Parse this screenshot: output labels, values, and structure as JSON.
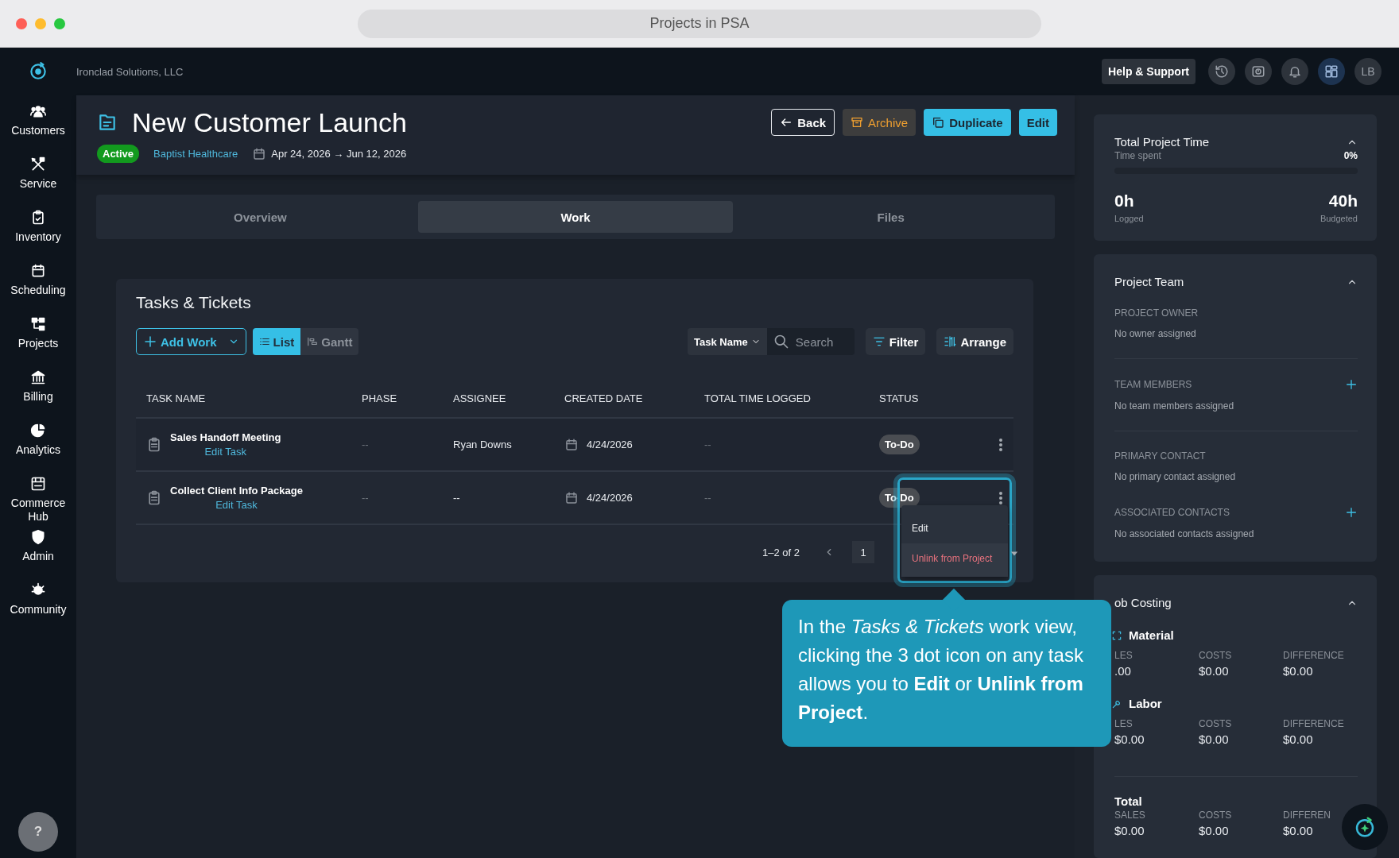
{
  "window": {
    "title": "Projects in PSA"
  },
  "topbar": {
    "company": "Ironclad Solutions, LLC",
    "help": "Help & Support",
    "avatar": "LB"
  },
  "sidebar": {
    "items": [
      {
        "label": "Customers"
      },
      {
        "label": "Service"
      },
      {
        "label": "Inventory"
      },
      {
        "label": "Scheduling"
      },
      {
        "label": "Projects"
      },
      {
        "label": "Billing"
      },
      {
        "label": "Analytics"
      },
      {
        "label": "Commerce Hub"
      },
      {
        "label": "Admin"
      },
      {
        "label": "Community"
      }
    ],
    "help_button": "?"
  },
  "project": {
    "title": "New Customer Launch",
    "status": {
      "label": "Active",
      "kind": "active"
    },
    "customer": "Baptist Healthcare",
    "dates": "Apr 24, 2026 → Jun 12, 2026",
    "actions": [
      {
        "label": "Back",
        "kind": "outline"
      },
      {
        "label": "Archive",
        "kind": "warning"
      },
      {
        "label": "Duplicate",
        "kind": "primary"
      },
      {
        "label": "Edit",
        "kind": "primary"
      }
    ]
  },
  "tabs": [
    {
      "label": "Overview",
      "selected": false
    },
    {
      "label": "Work",
      "selected": true
    },
    {
      "label": "Files",
      "selected": false
    }
  ],
  "tasks": {
    "title": "Tasks & Tickets",
    "add_work": "Add Work",
    "views": [
      {
        "label": "List",
        "selected": true
      },
      {
        "label": "Gantt",
        "selected": false
      }
    ],
    "search_by": "Task Name",
    "search": {
      "placeholder": "Search"
    },
    "filter": "Filter",
    "arrange": "Arrange",
    "columns": [
      "TASK NAME",
      "PHASE",
      "ASSIGNEE",
      "CREATED DATE",
      "TOTAL TIME LOGGED",
      "STATUS"
    ],
    "rows": [
      {
        "name": "Sales Handoff Meeting",
        "link": "Edit Task",
        "phase": "--",
        "assignee": "Ryan Downs",
        "created": "4/24/2026",
        "time": "--",
        "status": "To-Do"
      },
      {
        "name": "Collect Client Info Package",
        "link": "Edit Task",
        "phase": "--",
        "assignee": "--",
        "created": "4/24/2026",
        "time": "--",
        "status": "To-Do"
      }
    ],
    "pagination": {
      "range": "1–2 of 2",
      "page": "1"
    },
    "menu": {
      "items": [
        {
          "label": "Edit",
          "kind": "normal"
        },
        {
          "label": "Unlink from Project",
          "kind": "danger"
        }
      ]
    }
  },
  "callout": {
    "text": "In the *Tasks & Tickets* work view, clicking the 3 dot icon on any task allows you to **Edit** or **Unlink from Project**."
  },
  "time_card": {
    "title": "Total Project Time",
    "subtitle": "Time spent",
    "percent": "0%",
    "level": 0,
    "expanded": true,
    "logged": "0h",
    "logged_label": "Logged",
    "budgeted": "40h",
    "budgeted_label": "Budgeted"
  },
  "team_card": {
    "title": "Project Team",
    "expanded": true,
    "sections": [
      {
        "label": "PROJECT OWNER",
        "value": "No owner assigned",
        "addable": false
      },
      {
        "label": "TEAM MEMBERS",
        "value": "No team members assigned",
        "addable": true
      },
      {
        "label": "PRIMARY CONTACT",
        "value": "No primary contact assigned",
        "addable": false
      },
      {
        "label": "ASSOCIATED CONTACTS",
        "value": "No associated contacts assigned",
        "addable": true
      }
    ]
  },
  "costing_card": {
    "title": "ob Costing",
    "expanded": true,
    "groups": [
      {
        "name": "Material",
        "cells": [
          {
            "label": "LES",
            "value": ".00"
          },
          {
            "label": "COSTS",
            "value": "$0.00"
          },
          {
            "label": "DIFFERENCE",
            "value": "$0.00"
          }
        ]
      },
      {
        "name": "Labor",
        "cells": [
          {
            "label": "LES",
            "value": "$0.00"
          },
          {
            "label": "COSTS",
            "value": "$0.00"
          },
          {
            "label": "DIFFERENCE",
            "value": "$0.00"
          }
        ]
      }
    ],
    "total": {
      "name": "Total",
      "cells": [
        {
          "label": "SALES",
          "value": "$0.00"
        },
        {
          "label": "COSTS",
          "value": "$0.00"
        },
        {
          "label": "DIFFEREN",
          "value": "$0.00"
        }
      ]
    }
  }
}
